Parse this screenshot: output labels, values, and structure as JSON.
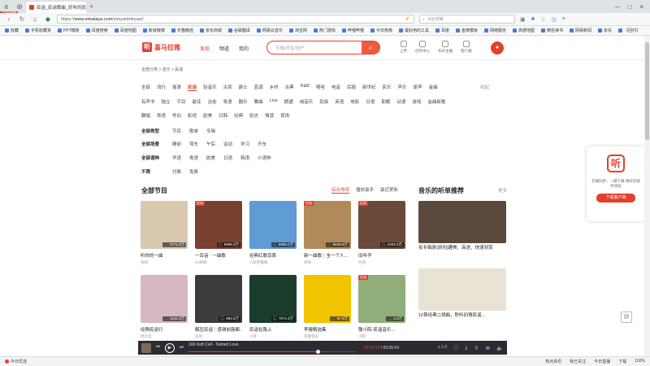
{
  "browser": {
    "tab_title": "民谣_民谣歌曲_好听的民谣在线收听_喜马拉雅FM",
    "download_badge": "下载管理",
    "url_scheme": "https://",
    "url_host": "www.ximalaya.com",
    "url_path": "/yinyue/minyao/",
    "search_placeholder": "点此搜索",
    "bookmarks": [
      "收藏",
      "手机收藏夹",
      "PPT模板",
      "百度搜索",
      "百度地图",
      "新浪微博",
      "天猫精选",
      "京东商城",
      "谷歌翻译",
      "网易云音乐",
      "淘宝网",
      "热门游戏",
      "哔哩哔哩",
      "今日热榜",
      "最好用的工具",
      "百度",
      "金牌模板",
      "网络服务",
      "高德地图",
      "微信读书",
      "网易新闻",
      "京东",
      "《回村》"
    ]
  },
  "site": {
    "brand": "喜马拉雅",
    "nav": [
      "发现",
      "频道",
      "我的"
    ],
    "search_placeholder": "专辑/声音/用户",
    "header_icons": [
      "上传",
      "创作中心",
      "有声主播",
      "客户端"
    ]
  },
  "breadcrumb": "全部分类 > 音乐 > 民谣",
  "categories": {
    "row1": [
      "全部",
      "流行",
      "摇滚",
      "民谣",
      "轻音乐",
      "古风",
      "爵士",
      "蓝调",
      "乡村",
      "古典",
      "R&B",
      "嘻哈",
      "电音",
      "后摇",
      "新世纪",
      "民乐",
      "声乐",
      "原声",
      "金曲"
    ],
    "row2": [
      "有声书",
      "独立",
      "节目",
      "最佳",
      "治愈",
      "粤语",
      "器乐",
      "舞曲",
      "Live",
      "朗诵",
      "纯音乐",
      "民族",
      "英语",
      "电影",
      "日语",
      "助眠",
      "动漫",
      "游戏",
      "金曲新歌"
    ],
    "row3": [
      "翻唱",
      "粤语",
      "怀旧",
      "影视",
      "欧美",
      "日韩",
      "经典",
      "励志",
      "情感",
      "现场"
    ],
    "more": "收起"
  },
  "filters": [
    {
      "label": "全部类型",
      "options": [
        "节目",
        "歌单",
        "专辑"
      ]
    },
    {
      "label": "全部场景",
      "options": [
        "睡前",
        "驾车",
        "午后",
        "运动",
        "学习",
        "开车"
      ]
    },
    {
      "label": "全部语种",
      "options": [
        "华语",
        "粤语",
        "欧美",
        "日语",
        "韩语",
        "小语种"
      ]
    },
    {
      "label": "不限",
      "options": [
        "付费",
        "免费"
      ]
    }
  ],
  "section": {
    "title": "全部节目",
    "sorts": [
      "综合排序",
      "播放最多",
      "最近更新"
    ]
  },
  "cards": [
    {
      "title": "听你的一曲",
      "author": "张琪",
      "count": "3771.0万",
      "color": "#d9c8b0",
      "tag": ""
    },
    {
      "title": "一百话 · 一曲歌",
      "author": "DJ明明",
      "count": "9989.3万",
      "color": "#7a4030",
      "tag": "优选"
    },
    {
      "title": "经典红歌百首",
      "author": "人民英雄联",
      "count": "5568.2万",
      "color": "#5f9bd5",
      "tag": ""
    },
    {
      "title": "新一曲歌｜全一个人...",
      "author": "青青",
      "count": "6848.8万",
      "color": "#b08a58",
      "tag": "优选"
    },
    {
      "title": "旧年华",
      "author": "毛伟",
      "count": "2403.3万",
      "color": "#6b4a3a",
      "tag": "优选"
    },
    {
      "title": "经典民谣行",
      "author": "周云云",
      "count": "1142.3万",
      "color": "#d6b8c4",
      "tag": ""
    },
    {
      "title": "解压民谣｜感谢前路都...",
      "author": "吴语",
      "count": "894.5万",
      "color": "#3c3c3c",
      "tag": ""
    },
    {
      "title": "民谣在路上",
      "author": "小李",
      "count": "7874.3万",
      "color": "#1c3d2e",
      "tag": ""
    },
    {
      "title": "李健精选集",
      "author": "李健音乐",
      "count": "97.9万",
      "color": "#f2c400",
      "tag": ""
    },
    {
      "title": "敬小院·民谣音乐...",
      "author": "小院",
      "count": "3.3万",
      "color": "#8fae7a",
      "tag": "优选"
    }
  ],
  "recommend": {
    "title": "音乐的听单推荐",
    "more": "更多",
    "items": [
      {
        "title": "有专辑原(原创)趣美、高进、快速到赏",
        "sub": "",
        "color": "#5b4a3c"
      },
      {
        "title": "10首经典二胡曲，聆听旧情民谣...",
        "sub": "",
        "color": "#e9e3d6"
      }
    ]
  },
  "promo": {
    "text": "云端同步，一键下载 更好的收听体验",
    "button": "下载客户端"
  },
  "player": {
    "track": "100-Soft Cell - Tainted Love",
    "current": "00:04:33",
    "total": "00:05:54",
    "progress": 0.77,
    "speed": "x 1.0"
  },
  "statusbar": {
    "left": "今日优选",
    "right": [
      "热点资讯",
      "我已关注",
      "今日直播",
      "下载",
      "100%"
    ]
  }
}
